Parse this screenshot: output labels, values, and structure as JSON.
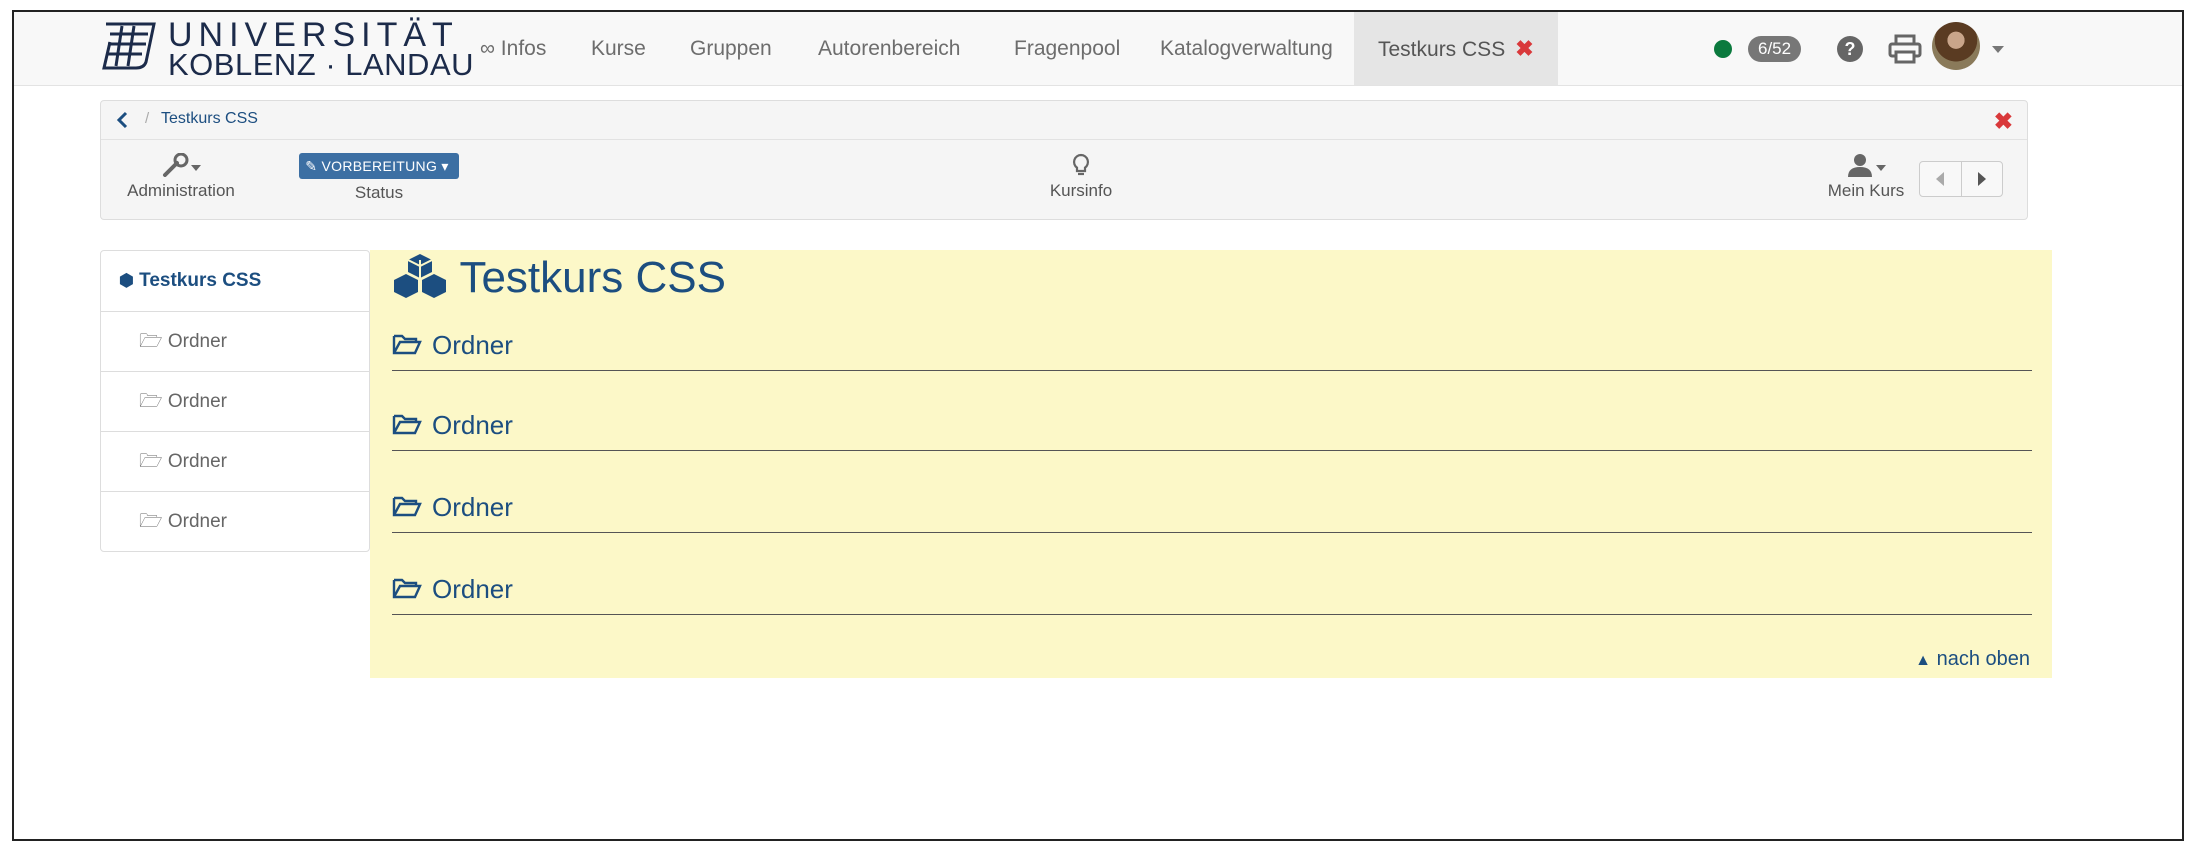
{
  "logo": {
    "line1": "UNIVERSITÄT",
    "line2": "KOBLENZ · LANDAU"
  },
  "nav": {
    "items": [
      {
        "label": "∞ Infos"
      },
      {
        "label": "Kurse"
      },
      {
        "label": "Gruppen"
      },
      {
        "label": "Autorenbereich"
      },
      {
        "label": "Fragenpool"
      },
      {
        "label": "Katalogverwaltung"
      },
      {
        "label": "Testkurs CSS",
        "active": true,
        "close_icon": "close-icon"
      }
    ],
    "status_color": "#0b7a3e",
    "badge": "6/52",
    "icons": [
      "help-icon",
      "print-icon",
      "avatar",
      "chevron-down-icon"
    ]
  },
  "toolbar": {
    "breadcrumb": {
      "sep": "/",
      "current": "Testkurs CSS"
    },
    "admin_label": "Administration",
    "status_button": "VORBEREITUNG",
    "status_label": "Status",
    "info_label": "Kursinfo",
    "mykurs_label": "Mein Kurs"
  },
  "sidebar": {
    "title": "Testkurs CSS",
    "items": [
      {
        "label": "Ordner"
      },
      {
        "label": "Ordner"
      },
      {
        "label": "Ordner"
      },
      {
        "label": "Ordner"
      }
    ]
  },
  "main": {
    "title": "Testkurs CSS",
    "folders": [
      {
        "label": "Ordner"
      },
      {
        "label": "Ordner"
      },
      {
        "label": "Ordner"
      },
      {
        "label": "Ordner"
      }
    ],
    "to_top": "nach oben",
    "background": "#fcf8c8"
  },
  "colors": {
    "accent": "#1c4e80",
    "close": "#d9383a",
    "status_button": "#3c6fa3"
  }
}
